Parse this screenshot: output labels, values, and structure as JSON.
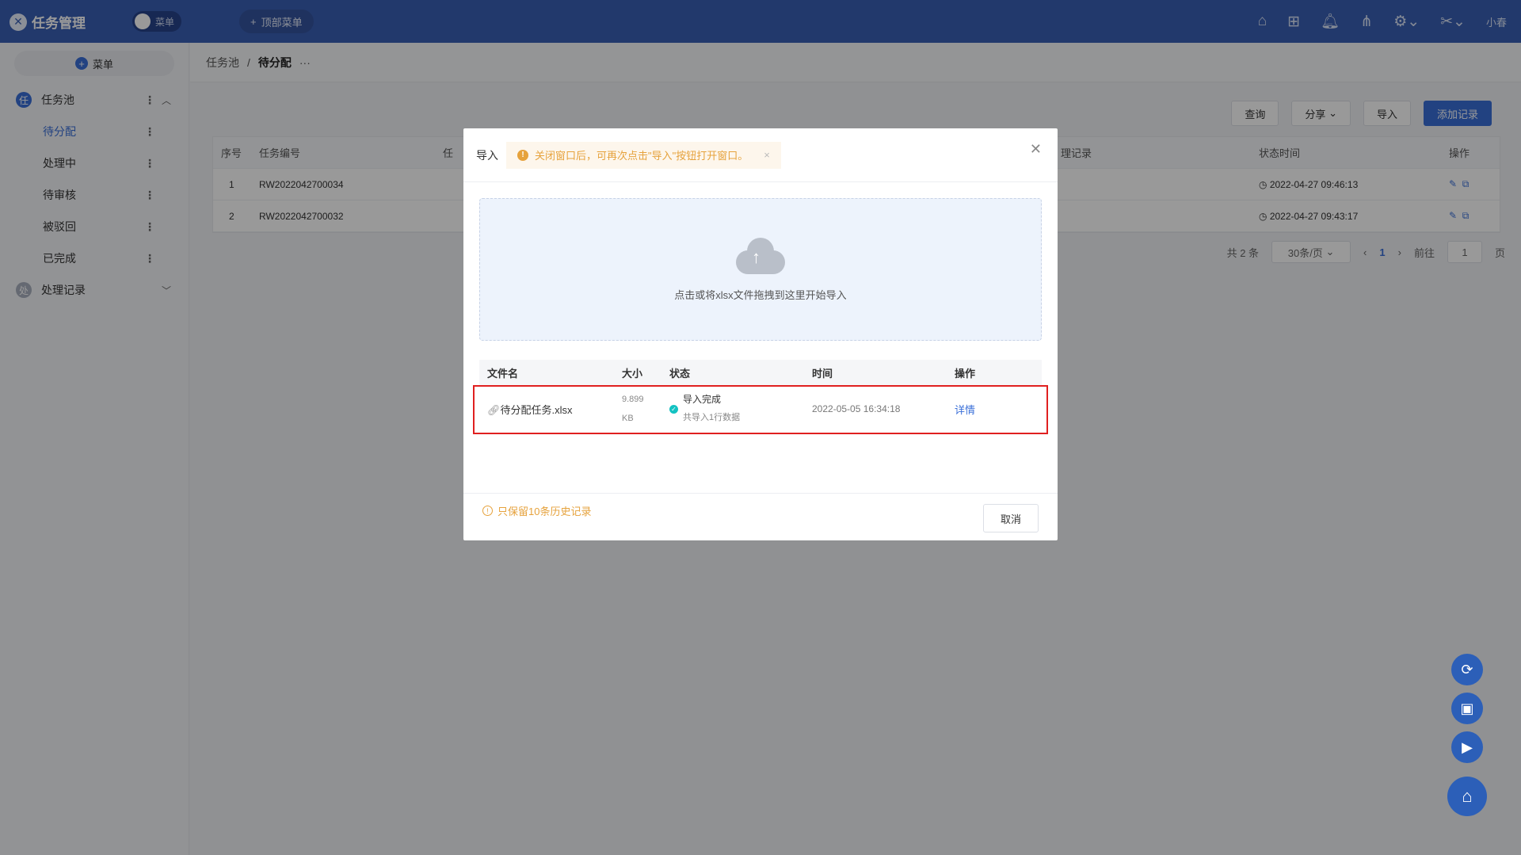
{
  "header": {
    "app_title": "任务管理",
    "menu_toggle": "菜单",
    "top_menu": "顶部菜单",
    "user": "小春"
  },
  "sidebar": {
    "menu_button": "菜单",
    "groups": [
      {
        "badge": "任",
        "label": "任务池",
        "color": "#3a6fd8"
      },
      {
        "badge": "处",
        "label": "处理记录",
        "color": "#a8b0bf"
      }
    ],
    "items": [
      {
        "label": "待分配"
      },
      {
        "label": "处理中"
      },
      {
        "label": "待审核"
      },
      {
        "label": "被驳回"
      },
      {
        "label": "已完成"
      }
    ]
  },
  "breadcrumb": {
    "root": "任务池",
    "separator": "/",
    "current": "待分配",
    "more": "···"
  },
  "toolbar": {
    "query": "查询",
    "share": "分享",
    "import": "导入",
    "add": "添加记录"
  },
  "table": {
    "headers": [
      "序号",
      "任务编号",
      "任",
      "理记录",
      "状态时间",
      "操作"
    ],
    "rows": [
      {
        "no": "1",
        "code": "RW2022042700034",
        "time": "2022-04-27 09:46:13"
      },
      {
        "no": "2",
        "code": "RW2022042700032",
        "time": "2022-04-27 09:43:17"
      }
    ]
  },
  "pagination": {
    "total": "共 2 条",
    "page_size": "30条/页",
    "current": "1",
    "goto": "前往",
    "goto_value": "1",
    "page_unit": "页"
  },
  "dialog": {
    "title": "导入",
    "notice": "关闭窗口后，可再次点击\"导入\"按钮打开窗口。",
    "upload_text": "点击或将xlsx文件拖拽到这里开始导入",
    "columns": [
      "文件名",
      "大小",
      "状态",
      "时间",
      "操作"
    ],
    "file": {
      "name": "待分配任务.xlsx",
      "size_value": "9.899",
      "size_unit": "KB",
      "status": "导入完成",
      "status_detail": "共导入1行数据",
      "time": "2022-05-05 16:34:18",
      "action": "详情"
    },
    "footer_note": "只保留10条历史记录",
    "cancel": "取消"
  },
  "colors": {
    "primary": "#3a6fd8",
    "header": "#3a5fb4",
    "warning": "#e6a23c",
    "success": "#13c2c2",
    "highlight": "#e02020"
  }
}
